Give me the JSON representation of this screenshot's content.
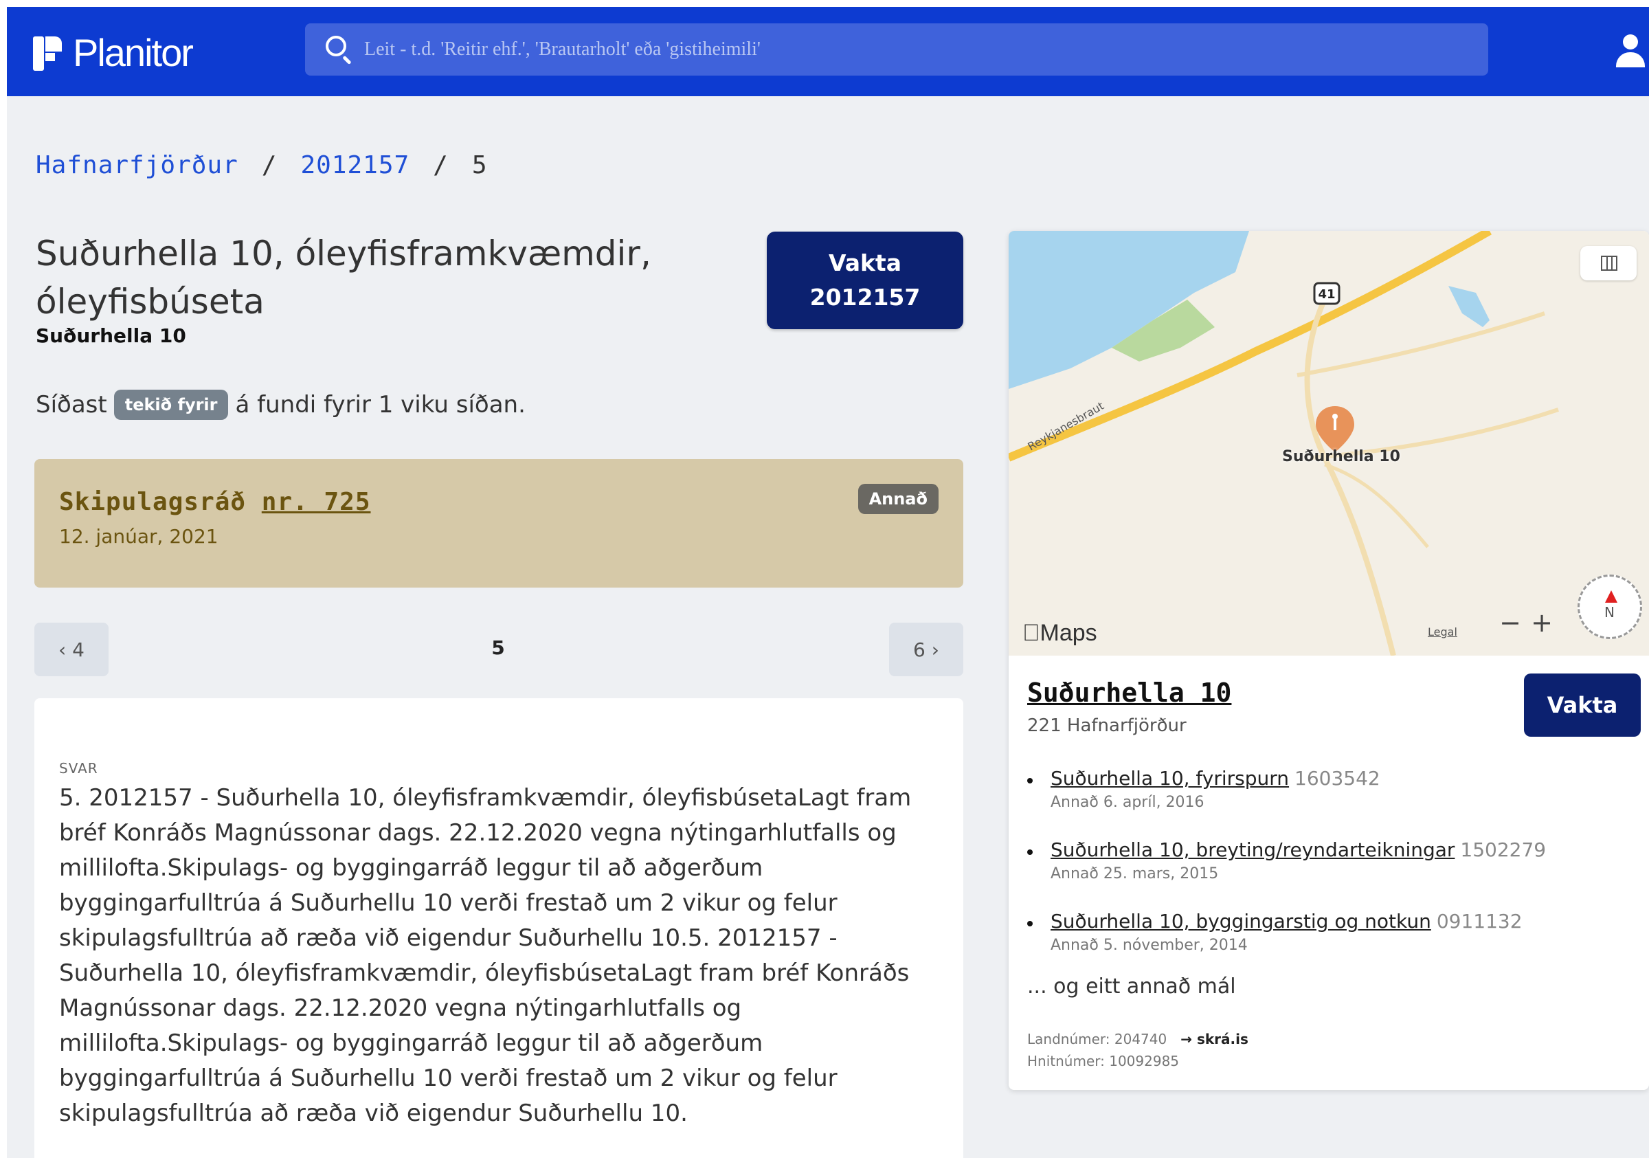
{
  "header": {
    "brand": "Planitor",
    "search_placeholder": "Leit - t.d. 'Reitir ehf.', 'Brautarholt' eða 'gistiheimili'"
  },
  "breadcrumb": {
    "items": [
      "Hafnarfjörður",
      "2012157",
      "5"
    ],
    "separator": "/"
  },
  "case": {
    "title": "Suðurhella 10, óleyfisframkvæmdir, óleyfisbúseta",
    "subtitle": "Suðurhella 10",
    "watch_button_line1": "Vakta",
    "watch_button_line2": "2012157",
    "last_prefix": "Síðast",
    "last_badge": "tekið fyrir",
    "last_suffix": "á fundi fyrir 1 viku síðan."
  },
  "meeting": {
    "title": "Skipulagsráð",
    "number": "nr. 725",
    "date": "12. janúar, 2021",
    "badge": "Annað",
    "badge_color": "#6a6862",
    "card_color": "#d6c9a8"
  },
  "pager": {
    "prev": "‹ 4",
    "current": "5",
    "next": "6 ›"
  },
  "answer": {
    "label": "SVAR",
    "text": "5. 2012157 - Suðurhella 10, óleyfisframkvæmdir, óleyfisbúsetaLagt fram bréf Konráðs Magnússonar dags. 22.12.2020 vegna nýtingarhlutfalls og millilofta.Skipulags- og byggingarráð leggur til að aðgerðum byggingarfulltrúa á Suðurhellu 10 verði frestað um 2 vikur og felur skipulagsfulltrúa að ræða við eigendur Suðurhellu 10.5. 2012157 - Suðurhella 10, óleyfisframkvæmdir, óleyfisbúsetaLagt fram bréf Konráðs Magnússonar dags. 22.12.2020 vegna nýtingarhlutfalls og millilofta.Skipulags- og byggingarráð leggur til að aðgerðum byggingarfulltrúa á Suðurhellu 10 verði frestað um 2 vikur og felur skipulagsfulltrúa að ræða við eigendur Suðurhellu 10."
  },
  "map": {
    "road_label": "Reykjanesbraut",
    "route_number": "41",
    "pin_label": "Suðurhella 10",
    "provider": "Maps",
    "legal": "Legal",
    "zoom_out": "−",
    "zoom_in": "+",
    "compass_label": "N",
    "pin_color": "#e8935a"
  },
  "property": {
    "title": "Suðurhella 10",
    "postal": "221 Hafnarfjörður",
    "watch_label": "Vakta",
    "cases": [
      {
        "title": "Suðurhella 10, fyrirspurn",
        "number": "1603542",
        "meta": "Annað 6. apríl, 2016"
      },
      {
        "title": "Suðurhella 10, breyting/reyndarteikningar",
        "number": "1502279",
        "meta": "Annað 25. mars, 2015"
      },
      {
        "title": "Suðurhella 10, byggingarstig og notkun",
        "number": "0911132",
        "meta": "Annað 5. nóvember, 2014"
      }
    ],
    "more": "... og eitt annað mál",
    "landnumer": "Landnúmer: 204740",
    "skra_link": "→ skrá.is",
    "hnitnumer": "Hnitnúmer: 10092985"
  },
  "colors": {
    "topbar": "#0d3bd1",
    "primary_button": "#0c2170",
    "link": "#1f4fd6"
  }
}
